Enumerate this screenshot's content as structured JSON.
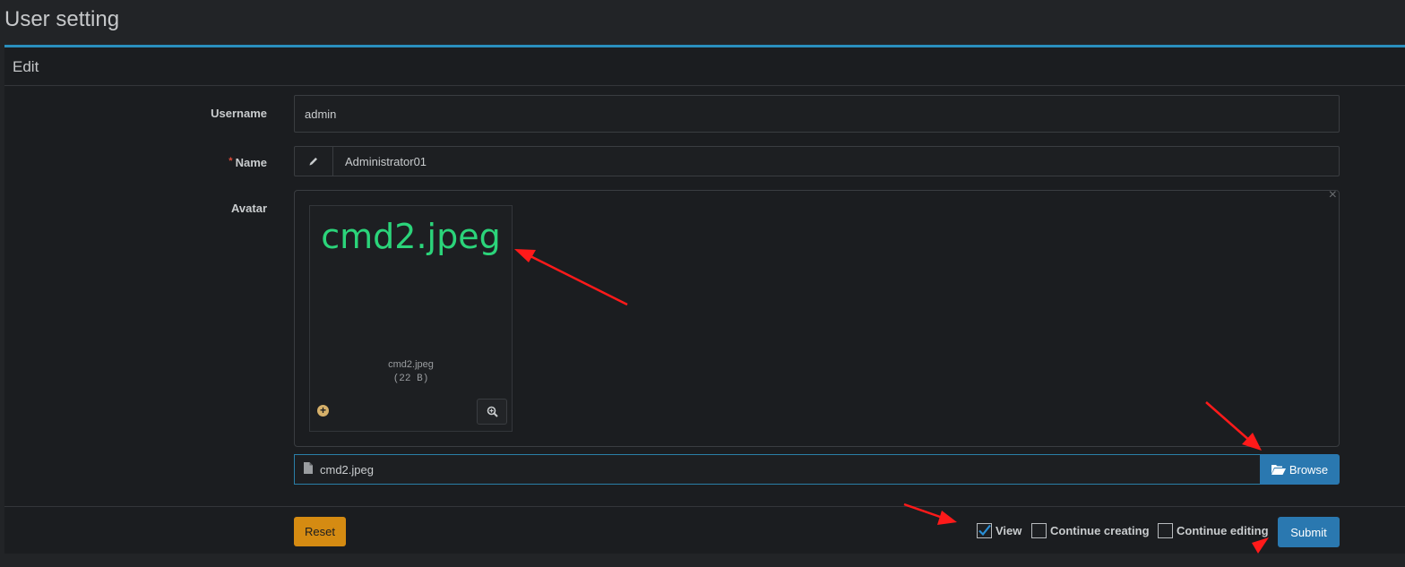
{
  "page": {
    "title": "User setting"
  },
  "panel": {
    "header": "Edit"
  },
  "form": {
    "username": {
      "label": "Username",
      "value": "admin"
    },
    "name": {
      "label": "Name",
      "required_mark": "*",
      "value": "Administrator01",
      "icon": "pencil-icon"
    },
    "avatar": {
      "label": "Avatar",
      "preview_text": "cmd2.jpeg",
      "caption": "cmd2.jpeg",
      "size": "(22 B)",
      "close_glyph": "×",
      "file_name": "cmd2.jpeg",
      "browse_label": "Browse"
    }
  },
  "footer": {
    "reset_label": "Reset",
    "view_label": "View",
    "view_checked": true,
    "continue_creating_label": "Continue creating",
    "continue_editing_label": "Continue editing",
    "submit_label": "Submit"
  },
  "colors": {
    "accent": "#2a8fbd",
    "primary_button": "#2a78b0",
    "warning_button": "#d58b12",
    "preview_text": "#2bd47a",
    "annotation_arrow": "#ff1a1a"
  }
}
